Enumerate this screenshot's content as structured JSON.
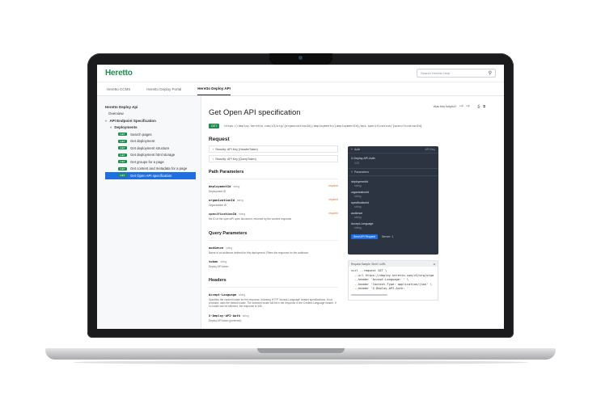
{
  "app": {
    "logo": "Heretto",
    "search_placeholder": "Search Heretto Help"
  },
  "tabs": [
    {
      "label": "Heretto CCMS"
    },
    {
      "label": "Heretto Deploy Portal"
    },
    {
      "label": "Heretto Deploy API"
    }
  ],
  "sidebar": {
    "root": "Heretto Deploy Api",
    "overview": "Overview",
    "group": "API Endpoint Specification",
    "subgroup": "Deployments",
    "endpoints": [
      {
        "method": "GET",
        "label": "Search pages"
      },
      {
        "method": "GET",
        "label": "Get deployment"
      },
      {
        "method": "GET",
        "label": "Get deployment structure"
      },
      {
        "method": "GET",
        "label": "Get deployment html storage"
      },
      {
        "method": "GET",
        "label": "Get groups for a page"
      },
      {
        "method": "GET",
        "label": "Get content and metadata for a page"
      },
      {
        "method": "GET",
        "label": "Get Open API specification"
      }
    ]
  },
  "content": {
    "helpful": "Was this helpful?",
    "title": "Get Open API specification",
    "method": "GET",
    "url": "https://deploy.heretto.com/v3/org/{organizationId}/deployments/{deploymentId}/api-specification/{specificationId}",
    "request_title": "Request",
    "security": [
      {
        "label": "Security: API Key (HeaderToken)"
      },
      {
        "label": "Security: API Key (QueryToken)"
      }
    ],
    "path_title": "Path Parameters",
    "path_params": [
      {
        "name": "deploymentId",
        "type": "string",
        "req": "required",
        "desc": "Deployment ID"
      },
      {
        "name": "organizationId",
        "type": "string",
        "req": "required",
        "desc": "Organization ID"
      },
      {
        "name": "specificationId",
        "type": "string",
        "req": "required",
        "desc": "the ID of the open API spec document, returned by the content response"
      }
    ],
    "query_title": "Query Parameters",
    "query_params": [
      {
        "name": "audience",
        "type": "string",
        "desc": "Name of an audience defined for this deployment. Filters the response for the audience."
      },
      {
        "name": "token",
        "type": "string",
        "desc": "Deploy API token"
      }
    ],
    "headers_title": "Headers",
    "headers": [
      {
        "name": "Accept-Language",
        "type": "string",
        "desc": "Specifies the content locale for the response, following HTTP 'Accept-Language' header specifications. If not provided, uses the default locale. The selected locale will be in the response in the Content-Language header. If no locale can be selected, the response is 406."
      },
      {
        "name": "X-Deploy-API-Auth",
        "type": "string",
        "desc": "Deploy API token (preferred)"
      }
    ]
  },
  "panel": {
    "head_left": "Auth",
    "head_right": "API Key",
    "auth_label": "X-Deploy-API-Auth",
    "auth_value": "123",
    "params_label": "Parameters",
    "fields": [
      {
        "name": "deploymentId",
        "value": "string"
      },
      {
        "name": "organizationId",
        "value": "string"
      },
      {
        "name": "specificationId",
        "value": "string"
      },
      {
        "name": "audience",
        "value": "string"
      },
      {
        "name": "Accept-Language",
        "value": "string"
      }
    ],
    "send_label": "Send API Request",
    "server_label": "Server: 1"
  },
  "code": {
    "head": "Request Sample: Shell / cURL",
    "lines": [
      "curl --request GET \\",
      "  --url https://deploy.heretto.com/v3/org/orga",
      "  --header 'Accept-Language: ' \\",
      "  --header 'Content-Type: application/json' \\",
      "  --header 'X-Deploy-API-Auth: '"
    ]
  }
}
